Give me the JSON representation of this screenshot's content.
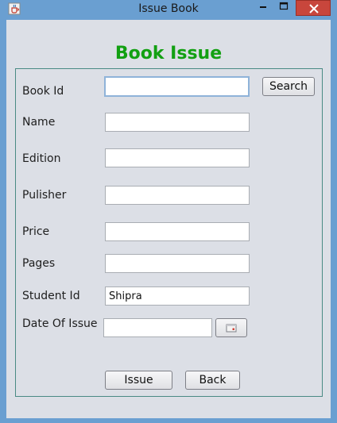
{
  "window": {
    "title": "Issue Book",
    "icon": "java-cup-icon",
    "controls": [
      "minimize-icon",
      "maximize-icon",
      "close-icon"
    ],
    "close_color": "#c8463c"
  },
  "form": {
    "heading": "Book Issue",
    "heading_color": "#12a012",
    "fields": {
      "book_id": {
        "label": "Book Id",
        "value": ""
      },
      "name": {
        "label": "Name",
        "value": ""
      },
      "edition": {
        "label": "Edition",
        "value": ""
      },
      "publisher": {
        "label": "Pulisher",
        "value": ""
      },
      "price": {
        "label": "Price",
        "value": ""
      },
      "pages": {
        "label": "Pages",
        "value": ""
      },
      "student_id": {
        "label": "Student Id",
        "value": "Shipra"
      },
      "date_of_issue": {
        "label": "Date Of Issue",
        "value": ""
      }
    },
    "buttons": {
      "search": "Search",
      "issue": "Issue",
      "back": "Back",
      "calendar_icon": "calendar-icon"
    }
  }
}
